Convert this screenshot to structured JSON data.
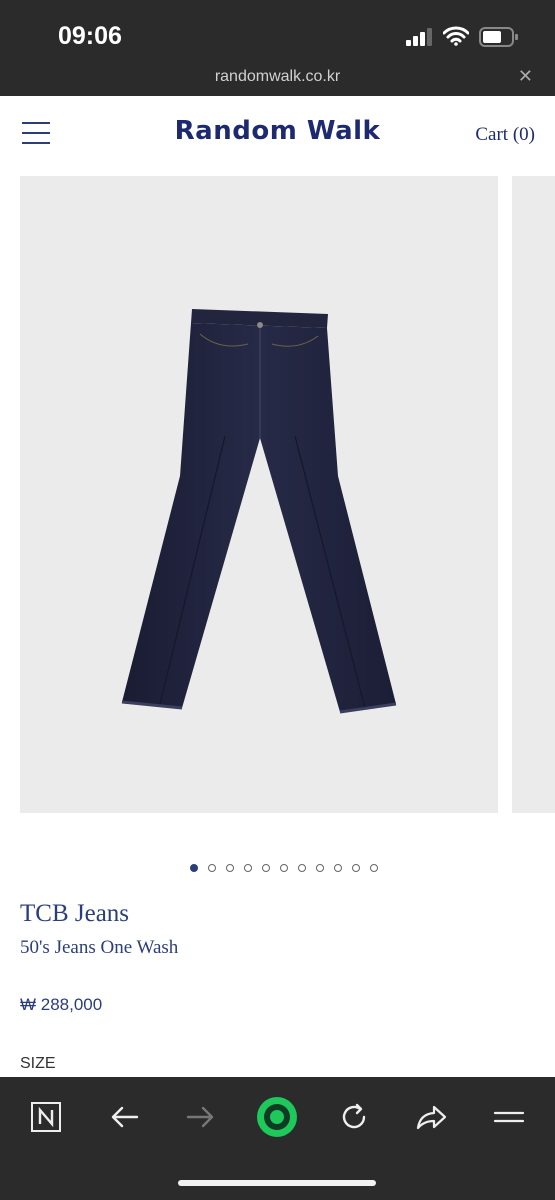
{
  "status_bar": {
    "time": "09:06"
  },
  "browser": {
    "url": "randomwalk.co.kr",
    "close_icon": "close-icon"
  },
  "header": {
    "brand": "Random Walk",
    "cart": "Cart (0)",
    "menu_icon": "hamburger-icon"
  },
  "gallery": {
    "image": "navy raw denim jeans on light gray background",
    "dots_total": 11,
    "active_index": 0
  },
  "product": {
    "brand": "TCB Jeans",
    "name": "50's Jeans One Wash",
    "price": "₩ 288,000",
    "size_label": "SIZE"
  },
  "bottom_bar": {
    "buttons": [
      "naver-n-icon",
      "back-arrow-icon",
      "forward-arrow-icon",
      "green-circle-icon",
      "reload-icon",
      "share-icon",
      "menu-icon"
    ]
  },
  "colors": {
    "accent": "#2c3e7a",
    "brand": "#1e2a6f",
    "bar": "#2b2b2b",
    "photo_bg": "#ebebeb",
    "green": "#1ec85a"
  }
}
